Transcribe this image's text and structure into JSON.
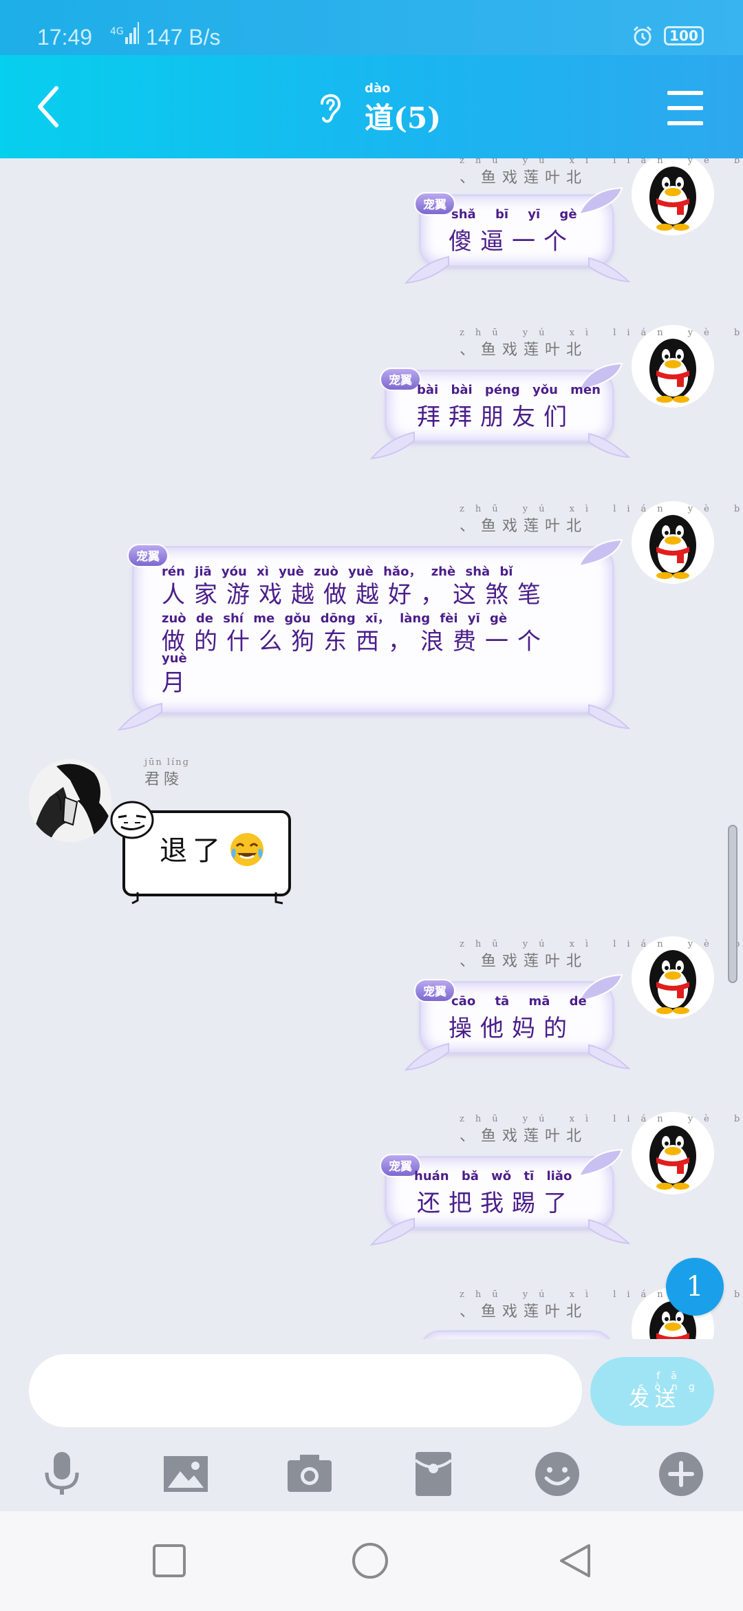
{
  "status_bar": {
    "time": "17:49",
    "network": "4G",
    "speed": "147 B/s",
    "battery": "100",
    "icons": [
      "signal-icon",
      "alarm-icon",
      "battery-icon"
    ]
  },
  "header": {
    "back_icon": "chevron-left-icon",
    "voice_icon": "ear-icon",
    "title_pinyin": "dào",
    "title": "道(5)",
    "menu_icon": "hamburger-menu-icon"
  },
  "messages": [
    {
      "side": "right",
      "sender": "、鱼戏莲叶北",
      "sender_pinyin": "zhū yú xì lián yè běi",
      "tag": "宠翼",
      "text_pinyin": "shǎ bī yī gè",
      "text": "傻逼一个"
    },
    {
      "side": "right",
      "sender": "、鱼戏莲叶北",
      "sender_pinyin": "zhū yú xì lián yè běi",
      "tag": "宠翼",
      "text_pinyin": "bài bài péng yǒu men",
      "text": "拜拜朋友们"
    },
    {
      "side": "right",
      "sender": "、鱼戏莲叶北",
      "sender_pinyin": "zhū yú xì lián yè běi",
      "tag": "宠翼",
      "lines": [
        {
          "pinyin": "rén jiā yóu xì yuè zuò yuè hǎo， zhè shà bǐ",
          "text": "人家游戏越做越好，这煞笔"
        },
        {
          "pinyin": "zuò de shí me gǒu dōng xī， làng fèi yī gè",
          "text": "做的什么狗东西，浪费一个"
        },
        {
          "pinyin": "yuè",
          "text": "月"
        }
      ]
    },
    {
      "side": "left",
      "sender": "君陵",
      "sender_pinyin": "jūn líng",
      "text": "退了",
      "emoji": "tears-of-joy-emoji"
    },
    {
      "side": "right",
      "sender": "、鱼戏莲叶北",
      "sender_pinyin": "zhū yú xì lián yè běi",
      "tag": "宠翼",
      "text_pinyin": "cāo tā mā de",
      "text": "操他妈的"
    },
    {
      "side": "right",
      "sender": "、鱼戏莲叶北",
      "sender_pinyin": "zhū yú xì lián yè běi",
      "tag": "宠翼",
      "text_pinyin": "huán bǎ wǒ tī liǎo",
      "text": "还把我踢了"
    },
    {
      "side": "right",
      "sender": "、鱼戏莲叶北",
      "sender_pinyin": "zhū yú xì lián yè běi"
    }
  ],
  "unread_badge": "1",
  "input": {
    "placeholder": "",
    "value": "",
    "send_pinyin": "fā sòng",
    "send_label": "发送"
  },
  "toolbar": [
    "microphone-icon",
    "image-icon",
    "camera-icon",
    "red-envelope-icon",
    "emoji-icon",
    "plus-icon"
  ],
  "nav": [
    "recent-apps-icon",
    "home-icon",
    "back-icon"
  ],
  "colors": {
    "header_start": "#07cfee",
    "header_end": "#2da8ef",
    "bubble_text": "#4b1e8a",
    "background": "#e9ebf2",
    "send_button": "#9fe4f5",
    "badge": "#1aa0ea"
  }
}
